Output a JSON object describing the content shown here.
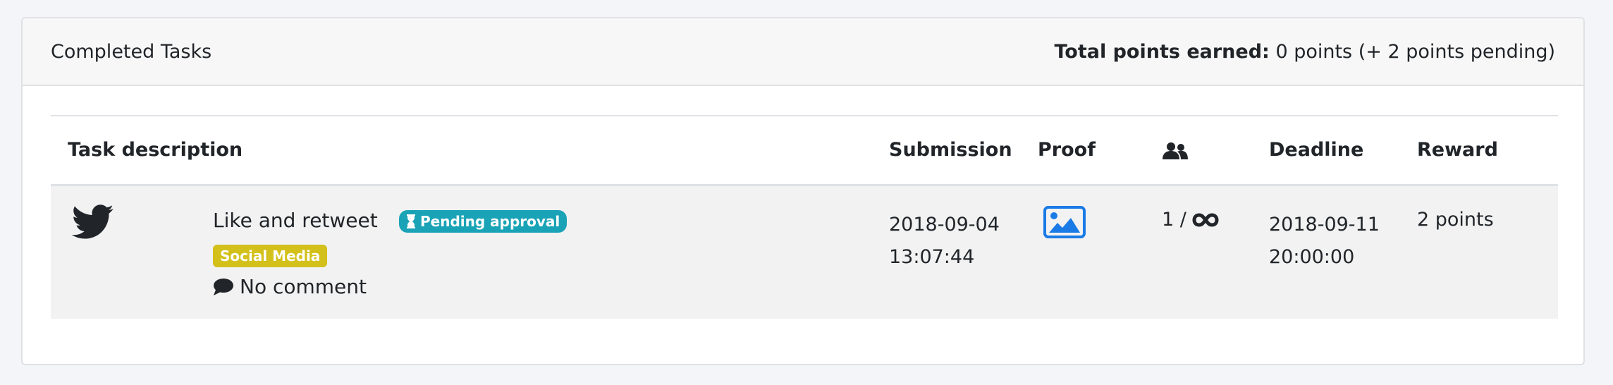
{
  "panel": {
    "title": "Completed Tasks",
    "points_label": "Total points earned:",
    "points_value": "0 points (+ 2 points pending)"
  },
  "table": {
    "headers": {
      "task_description": "Task description",
      "submission": "Submission",
      "proof": "Proof",
      "participants_icon": "users-icon",
      "deadline": "Deadline",
      "reward": "Reward"
    },
    "rows": [
      {
        "platform_icon": "twitter-icon",
        "title": "Like and retweet",
        "status_badge": "Pending approval",
        "category_badge": "Social Media",
        "comment": "No comment",
        "submission_date": "2018-09-04",
        "submission_time": "13:07:44",
        "proof_icon": "image-icon",
        "participants": "1 /",
        "participants_limit_icon": "infinity-icon",
        "deadline_date": "2018-09-11",
        "deadline_time": "20:00:00",
        "reward": "2 points"
      }
    ]
  },
  "colors": {
    "page_bg": "#f3f5f8",
    "header_bg": "#f7f7f7",
    "row_bg": "#f2f2f2",
    "pending_badge": "#1aa3b6",
    "category_badge": "#d3c01a",
    "proof_icon": "#1a7be6"
  }
}
